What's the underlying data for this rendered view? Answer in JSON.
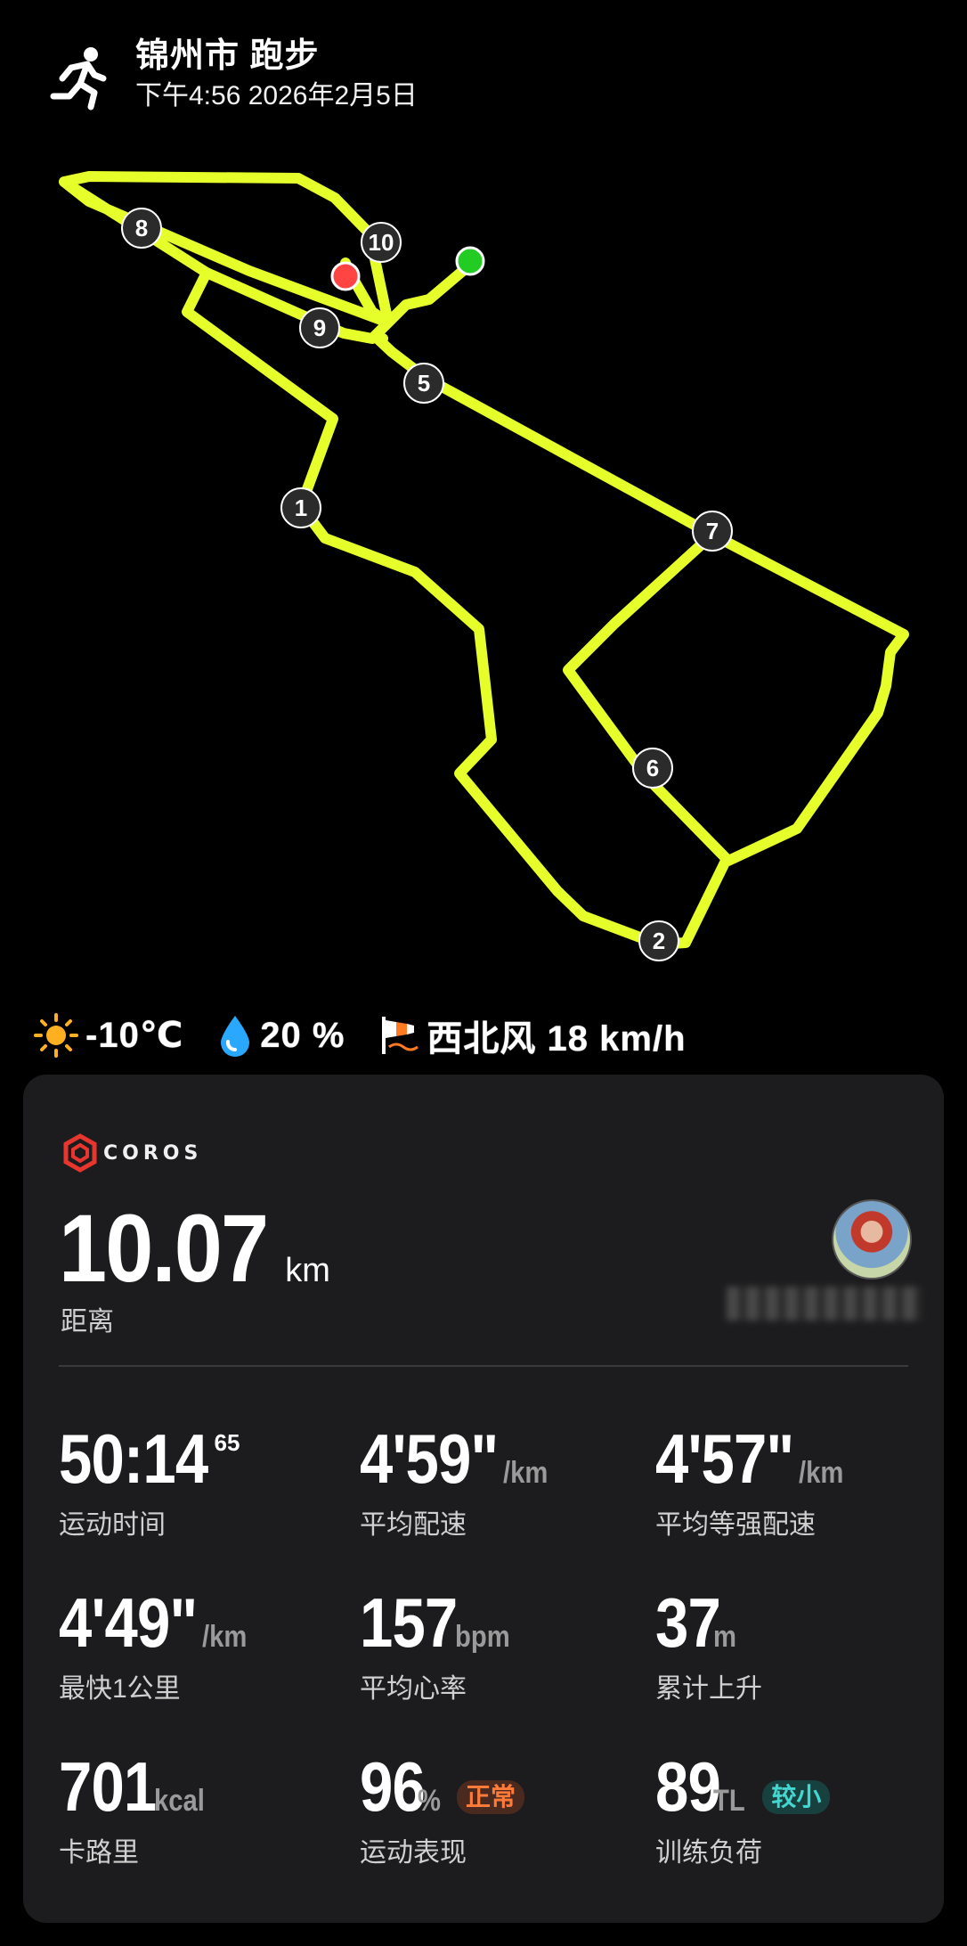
{
  "header": {
    "title": "锦州市 跑步",
    "datetime": "下午4:56 2026年2月5日",
    "activity_icon": "running-person-icon"
  },
  "map": {
    "route_color": "#e6ff2a",
    "start_color": "#22cc22",
    "end_color": "#ff4444",
    "km_markers": [
      "1",
      "2",
      "5",
      "6",
      "7",
      "8",
      "9",
      "10"
    ]
  },
  "weather": {
    "temperature": "-10℃",
    "humidity": "20 %",
    "wind": "西北风 18 km/h",
    "icons": [
      "sun-icon",
      "water-drop-icon",
      "windsock-icon"
    ]
  },
  "card": {
    "brand": "COROS",
    "distance": {
      "value": "10.07",
      "unit": "km",
      "label": "距离"
    },
    "stats": [
      {
        "value": "50:14",
        "sup": "65",
        "unit": "",
        "label": "运动时间"
      },
      {
        "value": "4'59\"",
        "unit": "/km",
        "label": "平均配速"
      },
      {
        "value": "4'57\"",
        "unit": "/km",
        "label": "平均等强配速"
      },
      {
        "value": "4'49\"",
        "unit": "/km",
        "label": "最快1公里"
      },
      {
        "value": "157",
        "unit": "bpm",
        "label": "平均心率"
      },
      {
        "value": "37",
        "unit": "m",
        "label": "累计上升"
      },
      {
        "value": "701",
        "unit": "kcal",
        "label": "卡路里"
      },
      {
        "value": "96",
        "unit": "%",
        "label": "运动表现",
        "badge": "正常"
      },
      {
        "value": "89",
        "unit": "TL",
        "label": "训练负荷",
        "badge": "较小"
      }
    ]
  }
}
